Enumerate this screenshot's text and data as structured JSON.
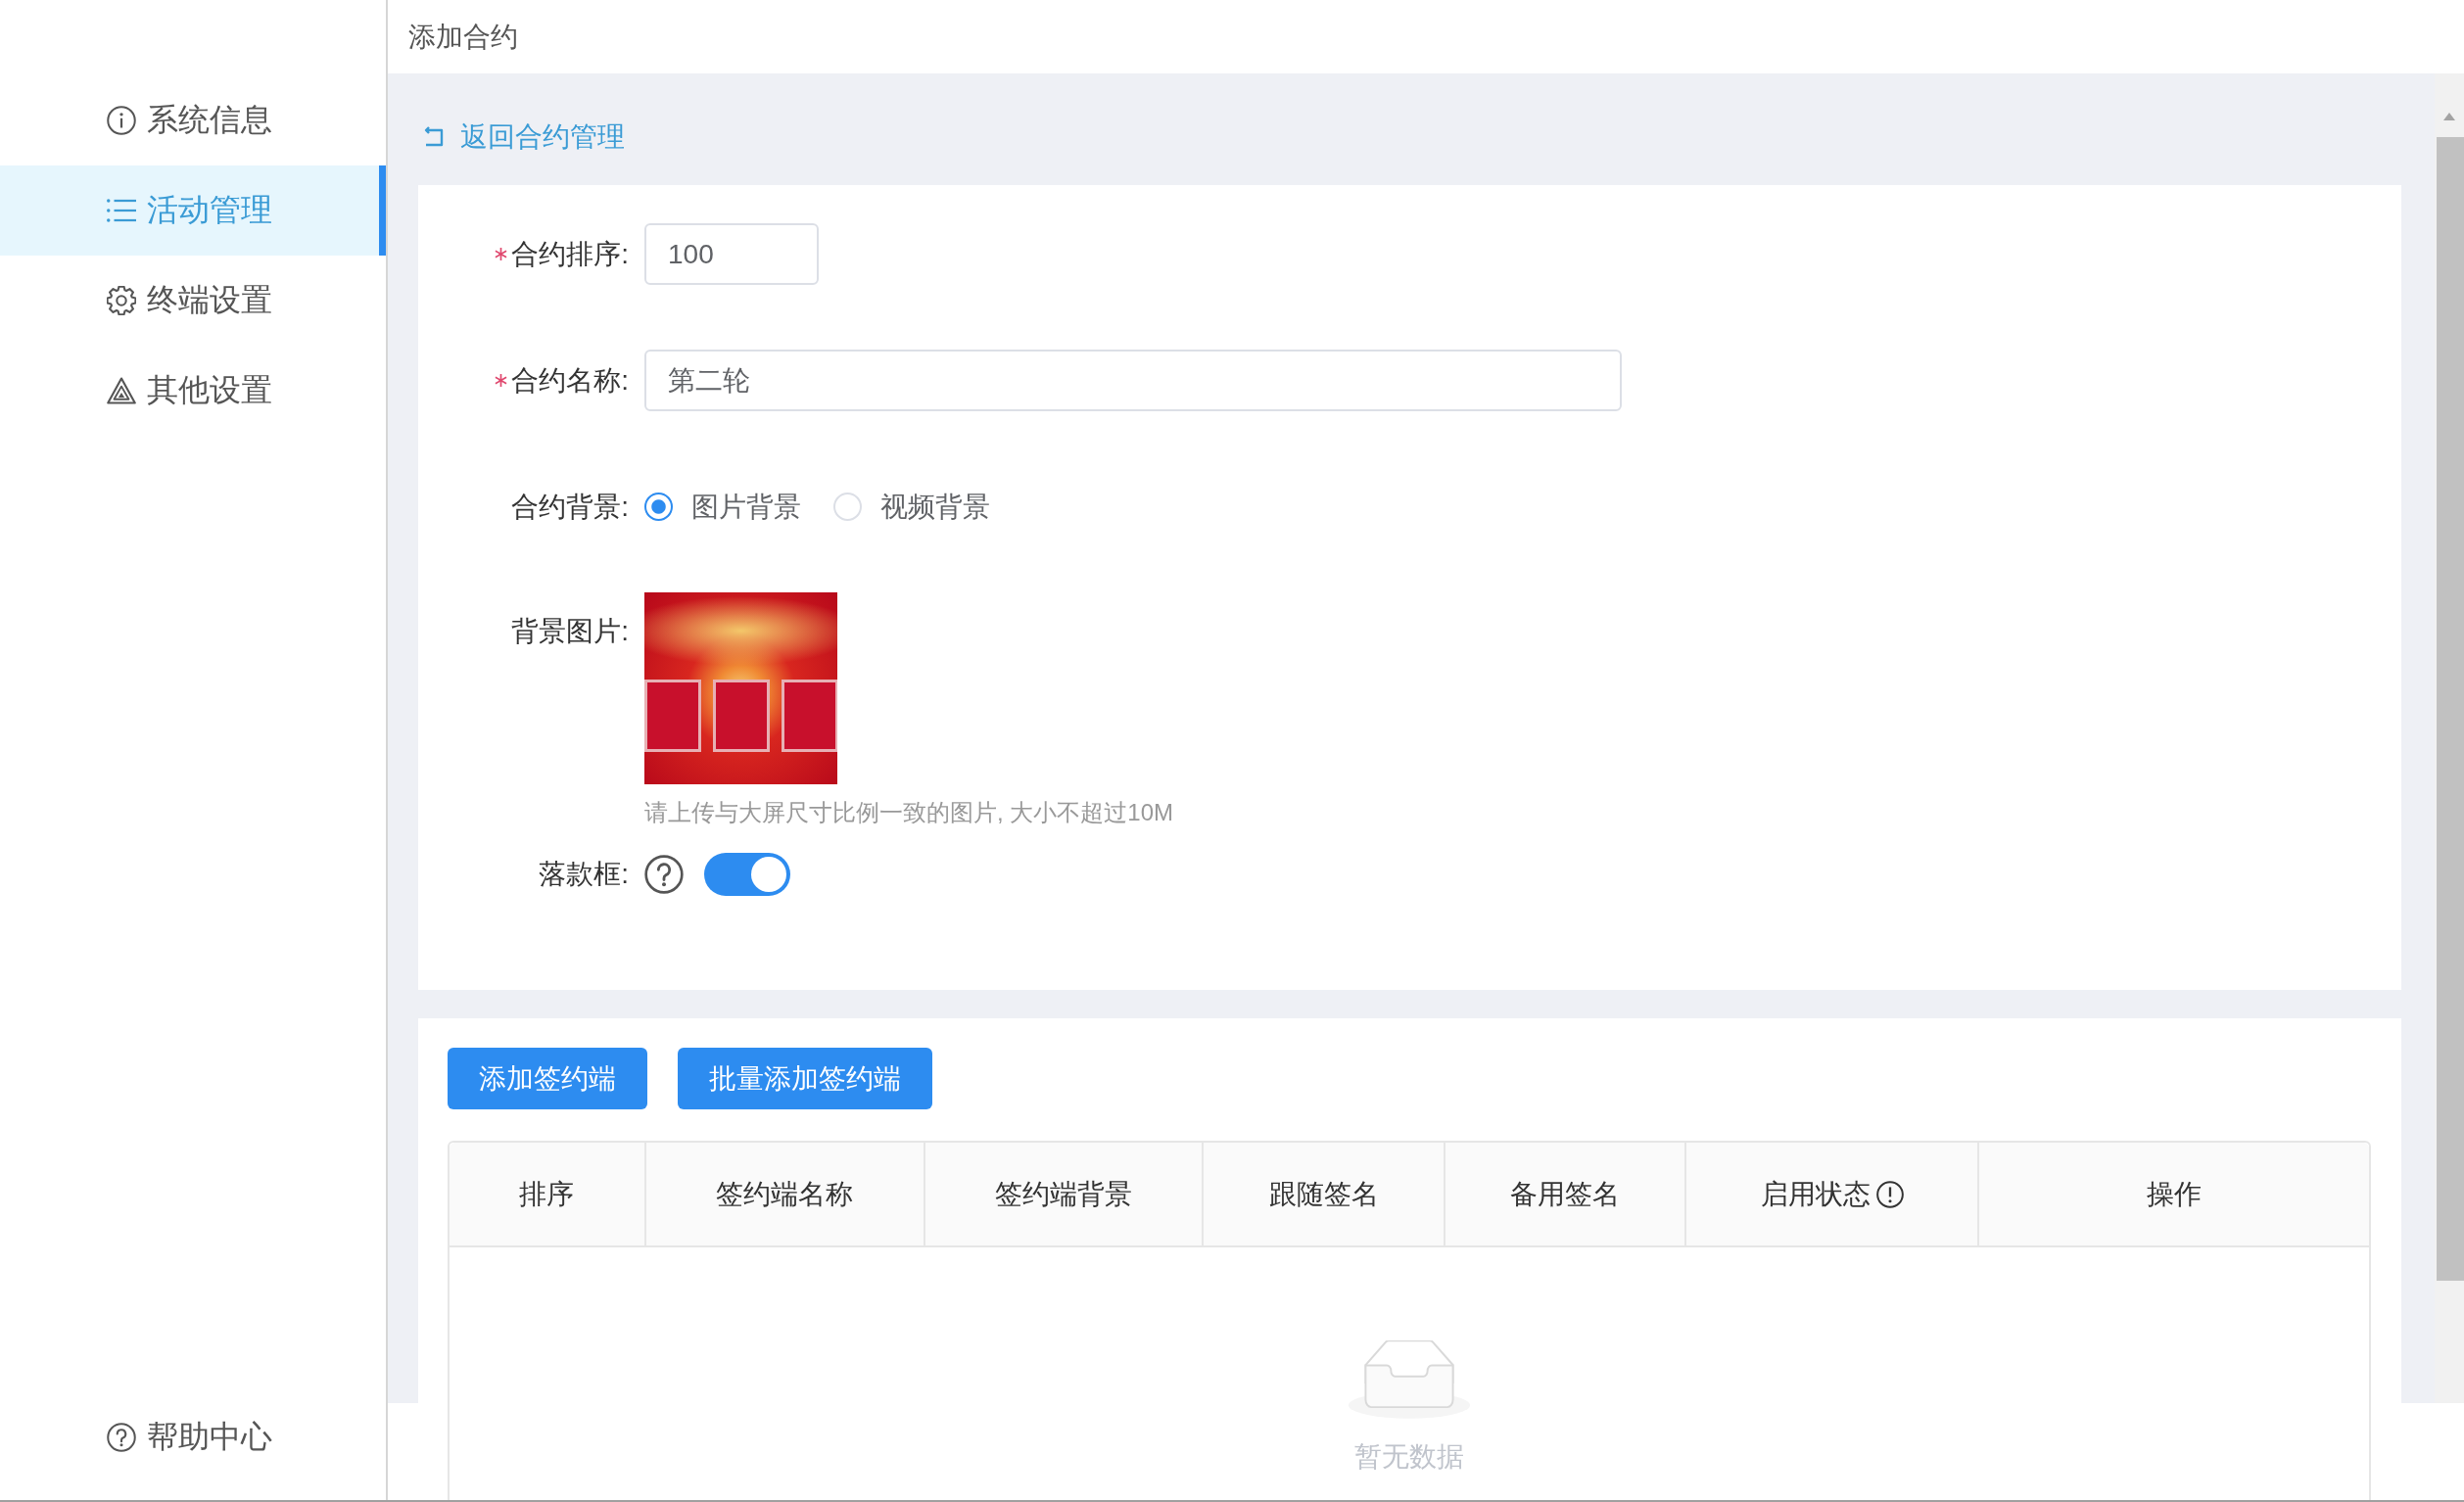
{
  "sidebar": {
    "items": [
      {
        "label": "系统信息",
        "selected": false
      },
      {
        "label": "活动管理",
        "selected": true
      },
      {
        "label": "终端设置",
        "selected": false
      },
      {
        "label": "其他设置",
        "selected": false
      }
    ],
    "footer": {
      "label": "帮助中心"
    }
  },
  "header": {
    "title": "添加合约"
  },
  "back_link": {
    "label": "返回合约管理"
  },
  "form": {
    "fields": [
      {
        "kind": "number",
        "label": "合约排序:",
        "required": true,
        "help": false,
        "value": "100"
      },
      {
        "kind": "text",
        "label": "合约名称:",
        "required": true,
        "help": false,
        "value": "第二轮"
      },
      {
        "kind": "radio",
        "label": "合约背景:",
        "required": false,
        "help": false,
        "options": [
          {
            "label": "图片背景",
            "selected": true
          },
          {
            "label": "视频背景",
            "selected": false
          }
        ]
      },
      {
        "kind": "image",
        "label": "背景图片:",
        "required": false,
        "help": false,
        "hint": "请上传与大屏尺寸比例一致的图片, 大小不超过10M"
      },
      {
        "kind": "switch",
        "label": "落款框:",
        "required": false,
        "help": true,
        "on": true
      }
    ]
  },
  "actions": [
    {
      "label": "添加签约端"
    },
    {
      "label": "批量添加签约端"
    }
  ],
  "table": {
    "columns": [
      {
        "label": "排序",
        "info": false
      },
      {
        "label": "签约端名称",
        "info": false
      },
      {
        "label": "签约端背景",
        "info": false
      },
      {
        "label": "跟随签名",
        "info": false
      },
      {
        "label": "备用签名",
        "info": false
      },
      {
        "label": "启用状态",
        "info": true
      },
      {
        "label": "操作",
        "info": false
      }
    ],
    "empty_text": "暂无数据"
  }
}
